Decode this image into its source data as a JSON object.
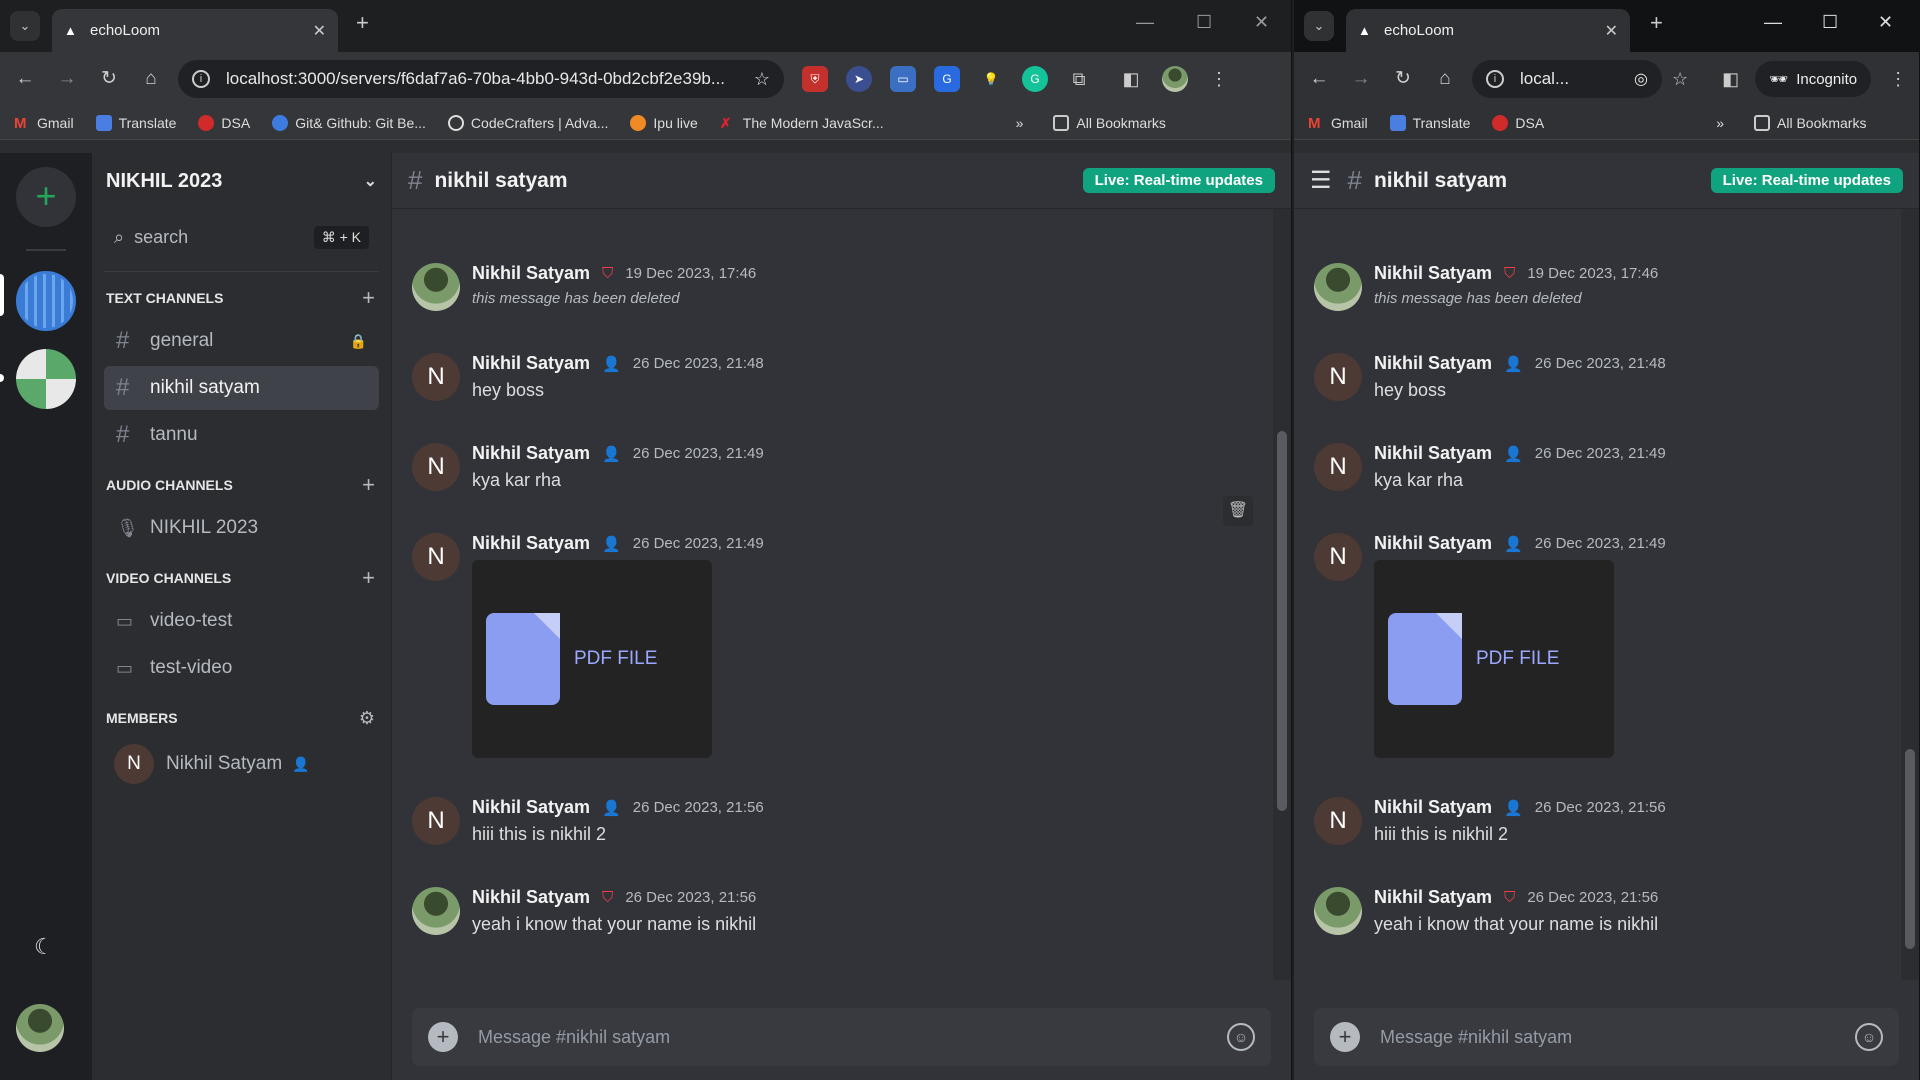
{
  "left": {
    "tab_title": "echoLoom",
    "url": "localhost:3000/servers/f6daf7a6-70ba-4bb0-943d-0bd2cbf2e39b...",
    "bookmarks": [
      "Gmail",
      "Translate",
      "DSA",
      "Git& Github: Git Be...",
      "CodeCrafters | Adva...",
      "Ipu live",
      "The Modern JavaScr..."
    ],
    "all_bookmarks": "All Bookmarks",
    "server_name": "NIKHIL 2023",
    "search_placeholder": "search",
    "search_shortcut": "⌘ + K",
    "sections": {
      "text": "TEXT CHANNELS",
      "audio": "AUDIO CHANNELS",
      "video": "VIDEO CHANNELS",
      "members": "MEMBERS"
    },
    "text_channels": [
      "general",
      "nikhil satyam",
      "tannu"
    ],
    "audio_channels": [
      "NIKHIL 2023"
    ],
    "video_channels": [
      "video-test",
      "test-video"
    ],
    "member_name": "Nikhil Satyam",
    "member_initial": "N"
  },
  "right": {
    "tab_title": "echoLoom",
    "url": "local...",
    "incognito": "Incognito",
    "bookmarks": [
      "Gmail",
      "Translate",
      "DSA"
    ],
    "all_bookmarks": "All Bookmarks"
  },
  "channel": {
    "name": "nikhil satyam",
    "live_badge": "Live: Real-time updates",
    "composer_placeholder": "Message #nikhil satyam"
  },
  "messages": [
    {
      "author": "Nikhil Satyam",
      "role": "moderator",
      "time": "19 Dec 2023, 17:46",
      "text": "this message has been deleted",
      "deleted": true
    },
    {
      "author": "Nikhil Satyam",
      "role": "guest",
      "time": "26 Dec 2023, 21:48",
      "text": "hey boss"
    },
    {
      "author": "Nikhil Satyam",
      "role": "guest",
      "time": "26 Dec 2023, 21:49",
      "text": "kya kar rha"
    },
    {
      "author": "Nikhil Satyam",
      "role": "guest",
      "time": "26 Dec 2023, 21:49",
      "file": "PDF FILE"
    },
    {
      "author": "Nikhil Satyam",
      "role": "guest",
      "time": "26 Dec 2023, 21:56",
      "text": "hiii this is nikhil 2"
    },
    {
      "author": "Nikhil Satyam",
      "role": "moderator",
      "time": "26 Dec 2023, 21:56",
      "text": "yeah i know that your name is nikhil"
    }
  ],
  "avatar_initial": "N",
  "colors": {
    "live_badge": "#10a37f",
    "moderator_icon": "#f23f43",
    "add_server": "#23a55a",
    "pdf_icon": "#8a9df0"
  }
}
